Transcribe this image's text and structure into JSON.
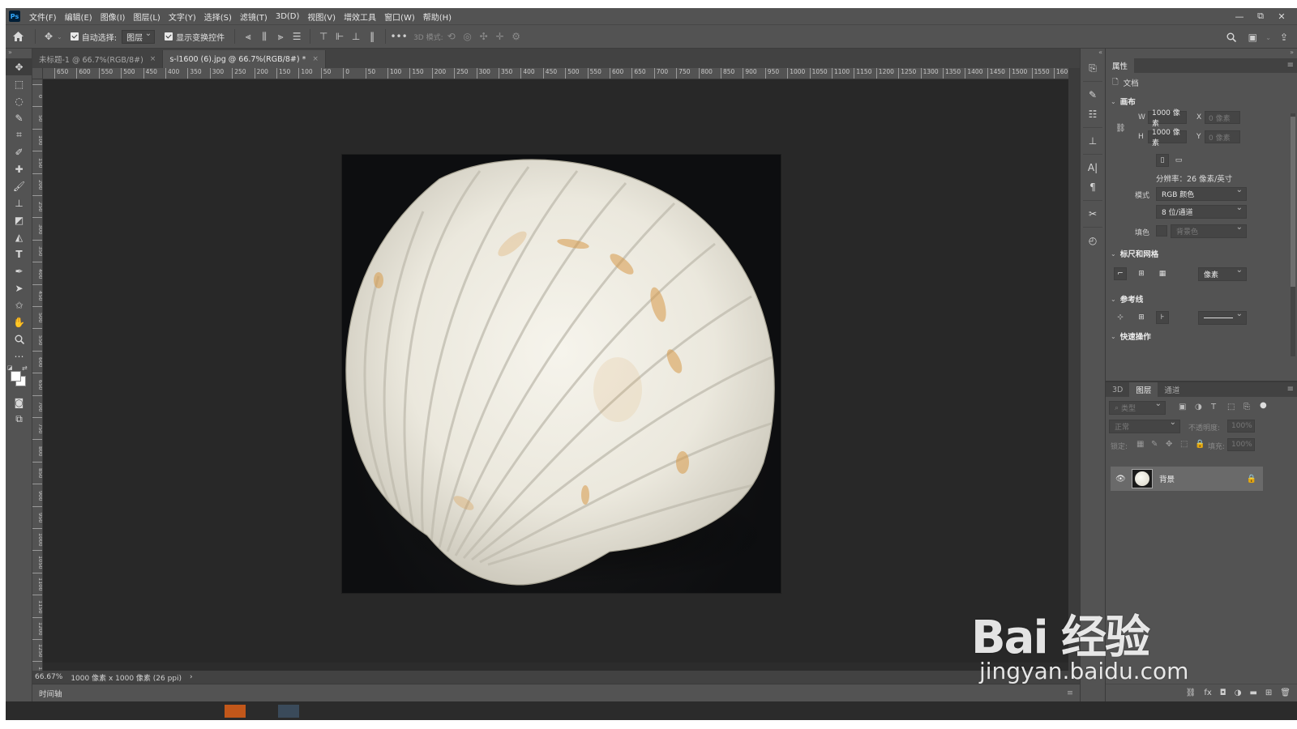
{
  "menubar": {
    "app_icon": "Ps",
    "items": [
      "文件(F)",
      "编辑(E)",
      "图像(I)",
      "图层(L)",
      "文字(Y)",
      "选择(S)",
      "滤镜(T)",
      "3D(D)",
      "视图(V)",
      "增效工具",
      "窗口(W)",
      "帮助(H)"
    ],
    "window_controls": [
      "—",
      "⧉",
      "✕"
    ]
  },
  "options": {
    "auto_select_label": "自动选择:",
    "auto_select_target": "图层",
    "show_transform_label": "显示变换控件",
    "mode_3d_label": "3D 模式:",
    "more_icon": "•••"
  },
  "tabs": [
    {
      "label": "未标题-1 @ 66.7%(RGB/8#)",
      "close": "×"
    },
    {
      "label": "s-l1600 (6).jpg @ 66.7%(RGB/8#) *",
      "close": "×"
    }
  ],
  "ruler": {
    "h_labels": [
      "650",
      "600",
      "550",
      "500",
      "450",
      "400",
      "350",
      "300",
      "250",
      "200",
      "150",
      "100",
      "50",
      "0",
      "50",
      "100",
      "150",
      "200",
      "250",
      "300",
      "350",
      "400",
      "450",
      "500",
      "550",
      "600",
      "650",
      "700",
      "750",
      "800",
      "850",
      "900",
      "950",
      "1000",
      "1050",
      "1100",
      "1150",
      "1200",
      "1250",
      "1300",
      "1350",
      "1400",
      "1450",
      "1500",
      "1550",
      "1600"
    ],
    "v_labels": [
      "0",
      "50",
      "100",
      "150",
      "200",
      "250",
      "300",
      "350",
      "400",
      "450",
      "500",
      "550",
      "600",
      "650",
      "700",
      "750",
      "800",
      "850",
      "900",
      "950",
      "1000",
      "1050",
      "1100",
      "1150",
      "1200",
      "1250",
      "1300",
      "1350"
    ]
  },
  "status": {
    "zoom": "66.67%",
    "doc_info": "1000 像素 x 1000 像素 (26 ppi)",
    "arrow": "›"
  },
  "timeline": {
    "label": "时间轴",
    "menu_icon": "≡"
  },
  "properties": {
    "tab": "属性",
    "doc_label": "文档",
    "canvas_section": "画布",
    "w_label": "W",
    "w_value": "1000 像素",
    "h_label": "H",
    "h_value": "1000 像素",
    "x_label": "X",
    "x_placeholder": "0 像素",
    "y_label": "Y",
    "y_placeholder": "0 像素",
    "resolution": "分辨率：26 像素/英寸",
    "mode_label": "模式",
    "mode_value": "RGB 颜色",
    "depth_value": "8 位/通道",
    "fill_label": "填色",
    "fill_value": "背景色",
    "rulers_section": "标尺和网格",
    "units_value": "像素",
    "guides_section": "参考线",
    "next_section": "快速操作"
  },
  "layers": {
    "tabs": [
      "3D",
      "图层",
      "通道"
    ],
    "active_tab": "图层",
    "search_placeholder": "类型",
    "blend_mode": "正常",
    "opacity_label": "不透明度:",
    "opacity_value": "100%",
    "lock_label": "锁定:",
    "fill_label": "填充:",
    "fill_value": "100%",
    "layer_name": "背景",
    "footer_icons": [
      "⛓",
      "fx",
      "◘",
      "◑",
      "▬",
      "⊞",
      "🗑"
    ]
  },
  "watermark": {
    "logo_text": "Bai 经验",
    "url": "jingyan.baidu.com"
  }
}
